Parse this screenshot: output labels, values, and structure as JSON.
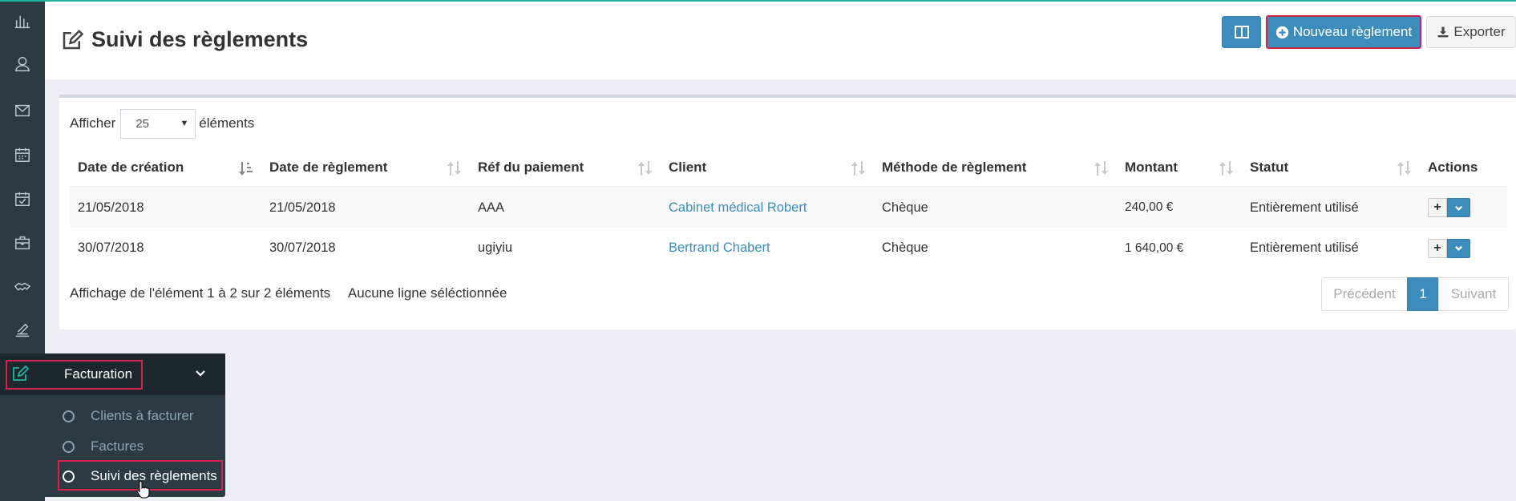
{
  "header": {
    "title": "Suivi des règlements",
    "new_button": "Nouveau règlement",
    "export_button": "Exporter"
  },
  "length_control": {
    "prefix": "Afficher",
    "value": "25",
    "suffix": "éléments"
  },
  "table": {
    "columns": [
      "Date de création",
      "Date de règlement",
      "Réf du paiement",
      "Client",
      "Méthode de règlement",
      "Montant",
      "Statut",
      "Actions"
    ],
    "rows": [
      {
        "created": "21/05/2018",
        "paid": "21/05/2018",
        "ref": "AAA",
        "client": "Cabinet médical Robert",
        "method": "Chèque",
        "amount": "240,00 €",
        "status": "Entièrement utilisé"
      },
      {
        "created": "30/07/2018",
        "paid": "30/07/2018",
        "ref": "ugiyiu",
        "client": "Bertrand Chabert",
        "method": "Chèque",
        "amount": "1 640,00 €",
        "status": "Entièrement utilisé"
      }
    ]
  },
  "footer": {
    "info": "Affichage de l'élément 1 à 2 sur 2 éléments",
    "selection": "Aucune ligne séléctionnée"
  },
  "pagination": {
    "prev": "Précédent",
    "current": "1",
    "next": "Suivant"
  },
  "sidebar": {
    "icons": [
      "chart-bar-icon",
      "user-icon",
      "mail-icon",
      "calendar-icon",
      "calendar-check-icon",
      "briefcase-icon",
      "handshake-icon",
      "sign-icon",
      "edit-icon",
      "chart-line-icon",
      "calculator-icon"
    ],
    "flyout": {
      "title": "Facturation",
      "items": [
        "Clients à facturer",
        "Factures",
        "Suivi des règlements"
      ]
    }
  },
  "colors": {
    "primary": "#3c8dbc",
    "sidebar": "#2c3b41",
    "accent": "#22b3a4",
    "highlight": "#d0234f"
  }
}
